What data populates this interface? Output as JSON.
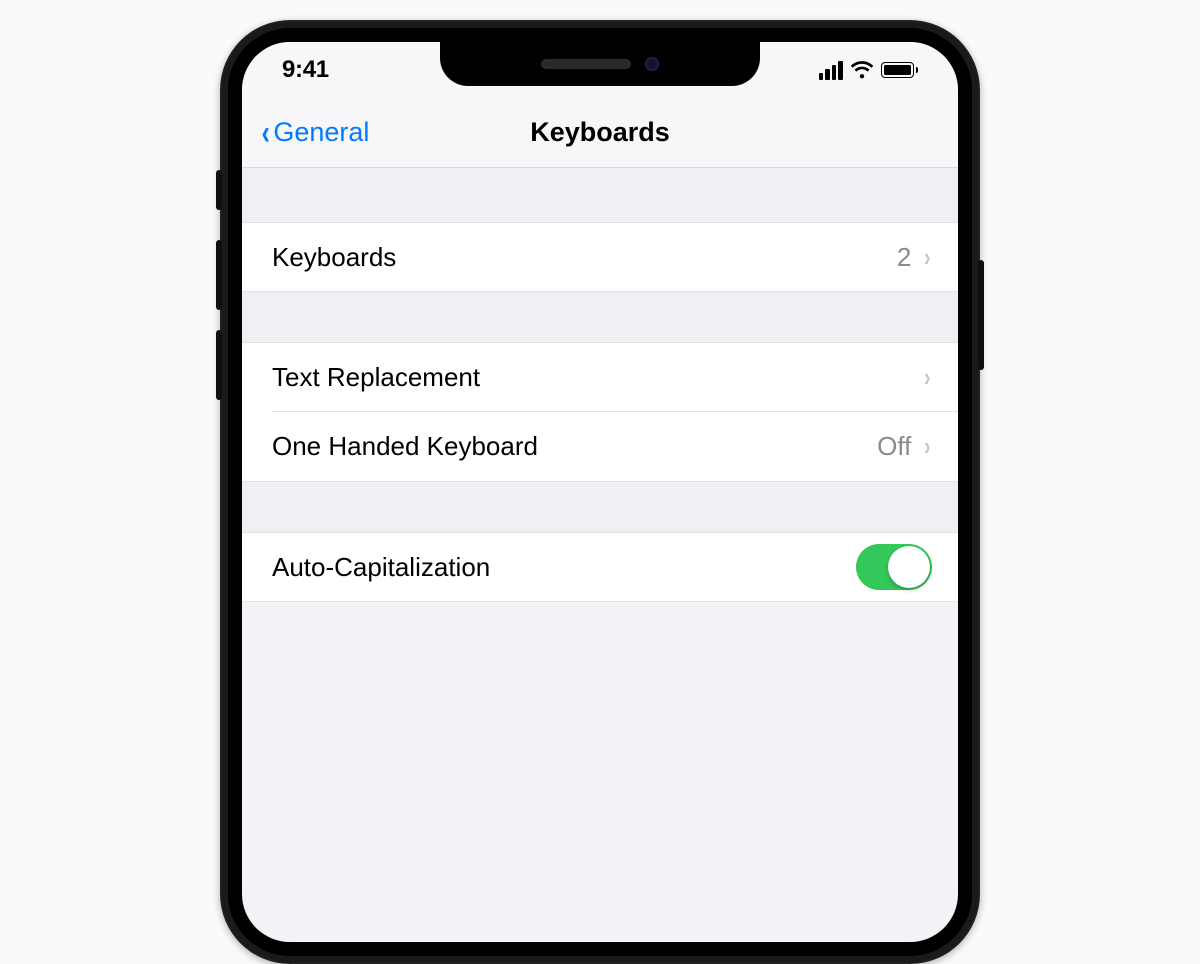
{
  "status": {
    "time": "9:41"
  },
  "nav": {
    "back_label": "General",
    "title": "Keyboards"
  },
  "rows": {
    "keyboards": {
      "label": "Keyboards",
      "value": "2"
    },
    "text_replacement": {
      "label": "Text Replacement"
    },
    "one_handed": {
      "label": "One Handed Keyboard",
      "value": "Off"
    },
    "auto_cap": {
      "label": "Auto-Capitalization",
      "on": true
    }
  },
  "colors": {
    "accent": "#007aff",
    "switch_on": "#34c759"
  }
}
